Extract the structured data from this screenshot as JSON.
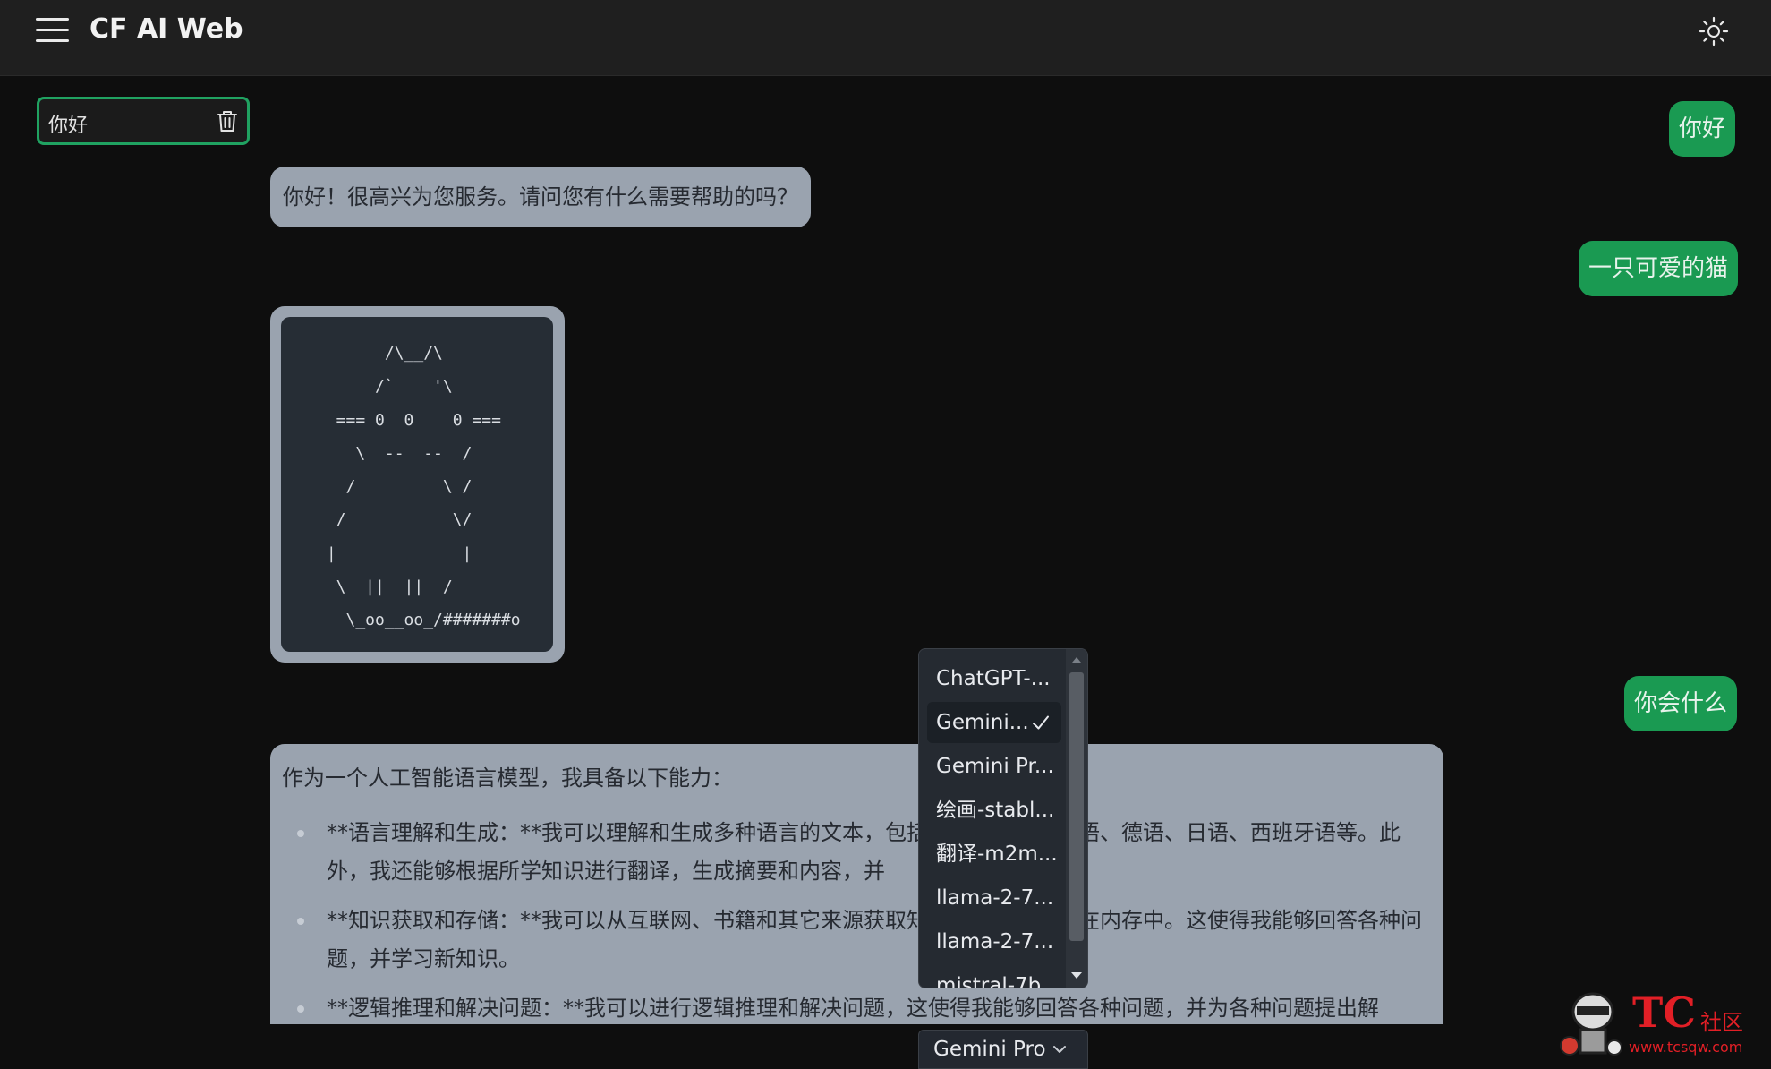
{
  "header": {
    "title": "CF AI Web"
  },
  "sidebar": {
    "sessions": [
      {
        "label": "你好"
      }
    ]
  },
  "chat": {
    "user_messages": [
      "你好",
      "一只可爱的猫",
      "你会什么"
    ],
    "ai_reply_1": "你好！很高兴为您服务。请问您有什么需要帮助的吗？",
    "ai_reply_2_code": "       /\\__/\\\n      /`    '\\\n  === 0  0    0 ===\n    \\  --  --  /\n   /         \\ /\n  /           \\/\n |             |\n  \\  ||  ||  /\n   \\_oo__oo_/#######o",
    "ai_reply_3": {
      "intro": "作为一个人工智能语言模型，我具备以下能力：",
      "items": [
        "**语言理解和生成：**我可以理解和生成多种语言的文本，包括英语、中文、法语、德语、日语、西班牙语等。此外，我还能够根据所学知识进行翻译，生成摘要和内容，并",
        "**知识获取和存储：**我可以从互联网、书籍和其它来源获取知识，并将其存储在内存中。这使得我能够回答各种问题，并学习新知识。",
        "**逻辑推理和解决问题：**我可以进行逻辑推理和解决问题，这使得我能够回答各种问题，并为各种问题提出解"
      ]
    }
  },
  "model_dropdown": {
    "options": [
      "ChatGPT-...",
      "Gemini...",
      "Gemini Pr...",
      "绘画-stabl...",
      "翻译-m2m...",
      "llama-2-7...",
      "llama-2-7...",
      "mistral-7b..."
    ],
    "selected_index": 1
  },
  "model_select": {
    "current": "Gemini Pro"
  },
  "watermark": {
    "brand": "TC",
    "suffix": "社区",
    "url": "www.tcsqw.com"
  },
  "colors": {
    "accent_green": "#1a9a52",
    "session_border": "#20a261",
    "ai_bubble": "#9aa3af",
    "code_bg": "#262d35",
    "watermark_red": "#e21f26"
  }
}
